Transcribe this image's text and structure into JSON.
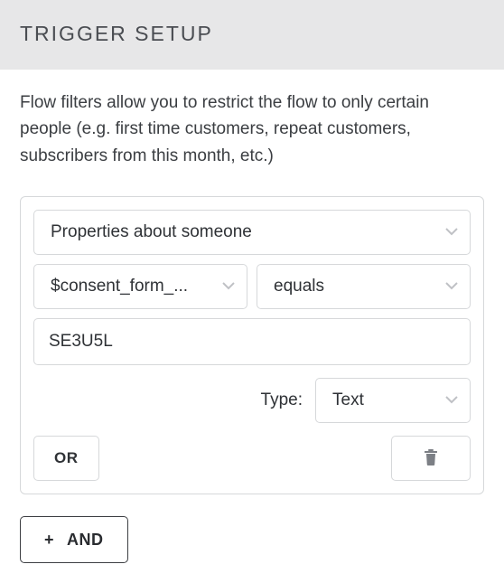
{
  "header": {
    "title": "TRIGGER SETUP"
  },
  "description": "Flow filters allow you to restrict the flow to only certain people (e.g. first time customers, repeat customers, subscribers from this month, etc.)",
  "filter": {
    "property_select": "Properties about someone",
    "field_select": "$consent_form_...",
    "operator_select": "equals",
    "value_input": "SE3U5L",
    "type_label": "Type:",
    "type_select": "Text",
    "or_label": "OR",
    "and_label": "AND"
  },
  "icons": {
    "plus": "+"
  }
}
